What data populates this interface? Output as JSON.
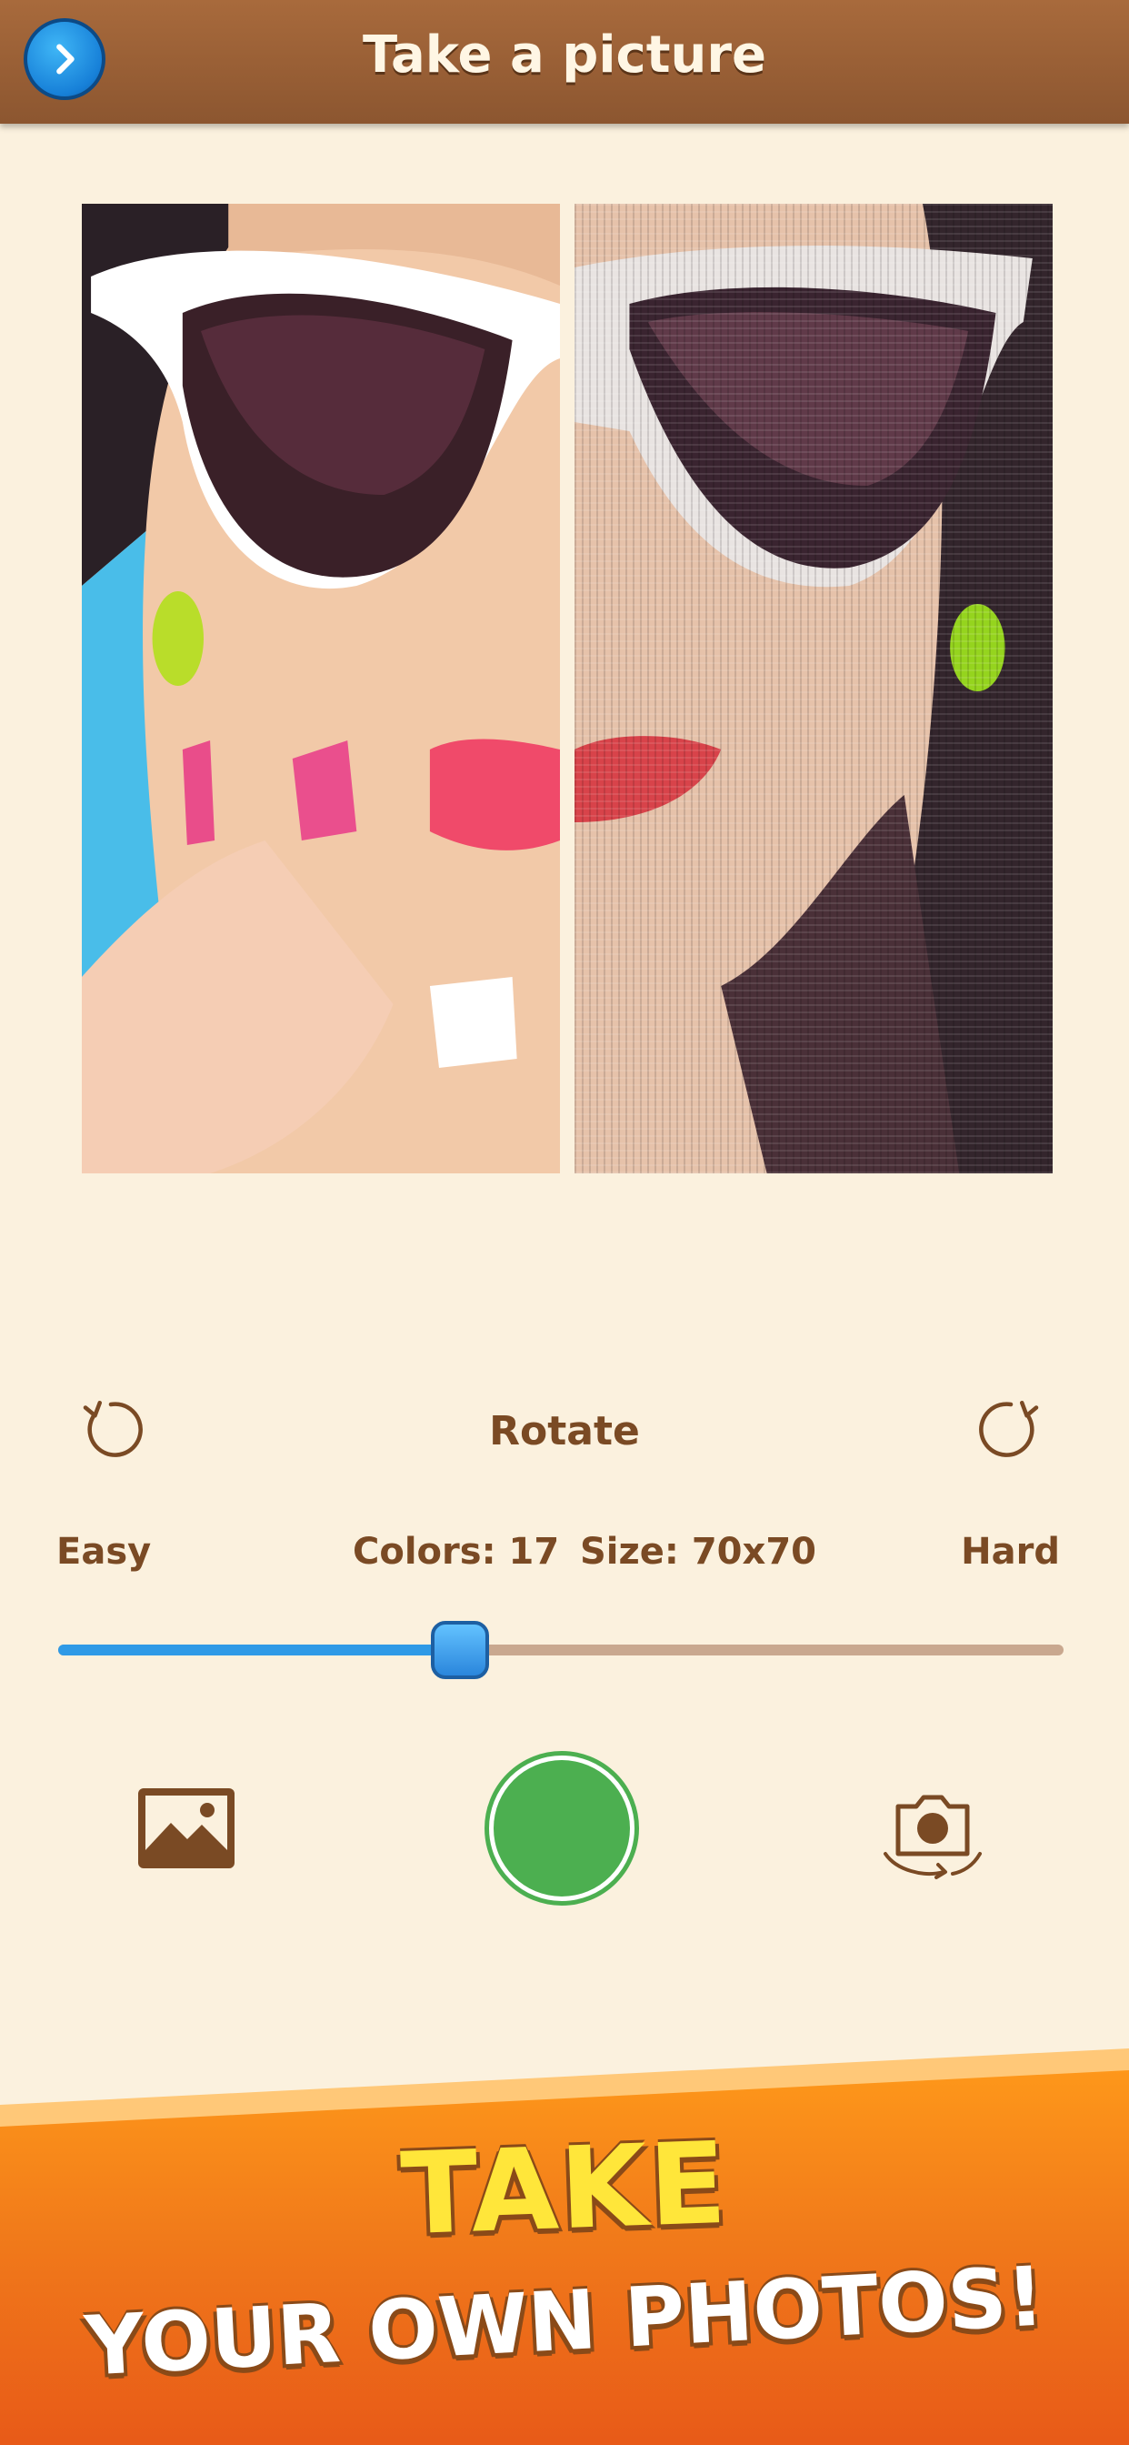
{
  "header": {
    "title": "Take a picture",
    "back_icon": "chevron-right-icon"
  },
  "preview": {
    "left_icon": "photo-original",
    "right_icon": "photo-cross-stitch"
  },
  "rotate": {
    "label": "Rotate",
    "left_icon": "rotate-left-icon",
    "right_icon": "rotate-right-icon"
  },
  "difficulty": {
    "easy_label": "Easy",
    "hard_label": "Hard",
    "colors_label": "Colors: 17",
    "size_label": "Size: 70x70",
    "slider_value": 0.4
  },
  "controls": {
    "gallery_icon": "gallery-icon",
    "shutter_icon": "shutter-button",
    "switch_camera_icon": "switch-camera-icon"
  },
  "promo": {
    "line1": "TAKE",
    "line2": "YOUR OWN PHOTOS!"
  },
  "colors": {
    "header": "#8c5630",
    "background": "#fbf1de",
    "text_brown": "#7a4a24",
    "slider_blue": "#2f9ae6",
    "shutter_green": "#4caf50",
    "promo_orange": "#f0781a",
    "promo_yellow": "#ffe63a"
  }
}
